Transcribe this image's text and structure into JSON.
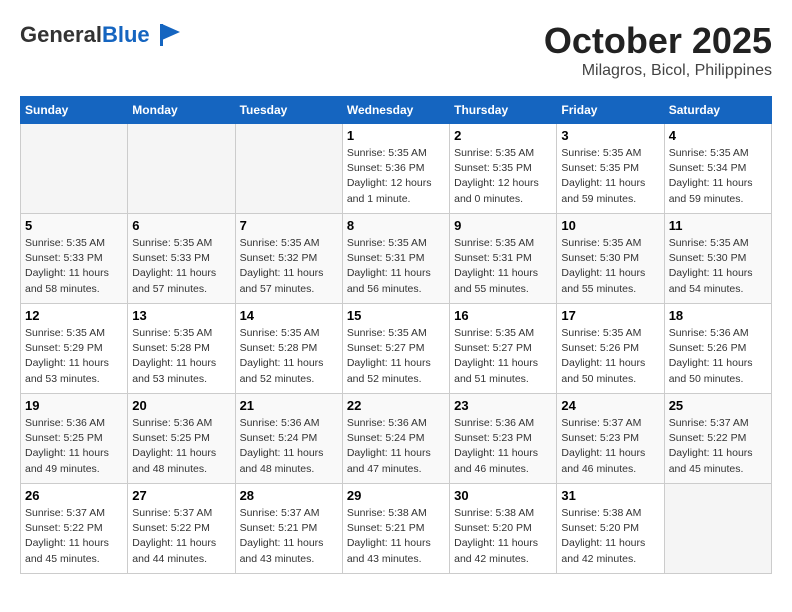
{
  "header": {
    "logo_general": "General",
    "logo_blue": "Blue",
    "month": "October 2025",
    "location": "Milagros, Bicol, Philippines"
  },
  "days_of_week": [
    "Sunday",
    "Monday",
    "Tuesday",
    "Wednesday",
    "Thursday",
    "Friday",
    "Saturday"
  ],
  "weeks": [
    [
      {
        "day": "",
        "info": ""
      },
      {
        "day": "",
        "info": ""
      },
      {
        "day": "",
        "info": ""
      },
      {
        "day": "1",
        "info": "Sunrise: 5:35 AM\nSunset: 5:36 PM\nDaylight: 12 hours\nand 1 minute."
      },
      {
        "day": "2",
        "info": "Sunrise: 5:35 AM\nSunset: 5:35 PM\nDaylight: 12 hours\nand 0 minutes."
      },
      {
        "day": "3",
        "info": "Sunrise: 5:35 AM\nSunset: 5:35 PM\nDaylight: 11 hours\nand 59 minutes."
      },
      {
        "day": "4",
        "info": "Sunrise: 5:35 AM\nSunset: 5:34 PM\nDaylight: 11 hours\nand 59 minutes."
      }
    ],
    [
      {
        "day": "5",
        "info": "Sunrise: 5:35 AM\nSunset: 5:33 PM\nDaylight: 11 hours\nand 58 minutes."
      },
      {
        "day": "6",
        "info": "Sunrise: 5:35 AM\nSunset: 5:33 PM\nDaylight: 11 hours\nand 57 minutes."
      },
      {
        "day": "7",
        "info": "Sunrise: 5:35 AM\nSunset: 5:32 PM\nDaylight: 11 hours\nand 57 minutes."
      },
      {
        "day": "8",
        "info": "Sunrise: 5:35 AM\nSunset: 5:31 PM\nDaylight: 11 hours\nand 56 minutes."
      },
      {
        "day": "9",
        "info": "Sunrise: 5:35 AM\nSunset: 5:31 PM\nDaylight: 11 hours\nand 55 minutes."
      },
      {
        "day": "10",
        "info": "Sunrise: 5:35 AM\nSunset: 5:30 PM\nDaylight: 11 hours\nand 55 minutes."
      },
      {
        "day": "11",
        "info": "Sunrise: 5:35 AM\nSunset: 5:30 PM\nDaylight: 11 hours\nand 54 minutes."
      }
    ],
    [
      {
        "day": "12",
        "info": "Sunrise: 5:35 AM\nSunset: 5:29 PM\nDaylight: 11 hours\nand 53 minutes."
      },
      {
        "day": "13",
        "info": "Sunrise: 5:35 AM\nSunset: 5:28 PM\nDaylight: 11 hours\nand 53 minutes."
      },
      {
        "day": "14",
        "info": "Sunrise: 5:35 AM\nSunset: 5:28 PM\nDaylight: 11 hours\nand 52 minutes."
      },
      {
        "day": "15",
        "info": "Sunrise: 5:35 AM\nSunset: 5:27 PM\nDaylight: 11 hours\nand 52 minutes."
      },
      {
        "day": "16",
        "info": "Sunrise: 5:35 AM\nSunset: 5:27 PM\nDaylight: 11 hours\nand 51 minutes."
      },
      {
        "day": "17",
        "info": "Sunrise: 5:35 AM\nSunset: 5:26 PM\nDaylight: 11 hours\nand 50 minutes."
      },
      {
        "day": "18",
        "info": "Sunrise: 5:36 AM\nSunset: 5:26 PM\nDaylight: 11 hours\nand 50 minutes."
      }
    ],
    [
      {
        "day": "19",
        "info": "Sunrise: 5:36 AM\nSunset: 5:25 PM\nDaylight: 11 hours\nand 49 minutes."
      },
      {
        "day": "20",
        "info": "Sunrise: 5:36 AM\nSunset: 5:25 PM\nDaylight: 11 hours\nand 48 minutes."
      },
      {
        "day": "21",
        "info": "Sunrise: 5:36 AM\nSunset: 5:24 PM\nDaylight: 11 hours\nand 48 minutes."
      },
      {
        "day": "22",
        "info": "Sunrise: 5:36 AM\nSunset: 5:24 PM\nDaylight: 11 hours\nand 47 minutes."
      },
      {
        "day": "23",
        "info": "Sunrise: 5:36 AM\nSunset: 5:23 PM\nDaylight: 11 hours\nand 46 minutes."
      },
      {
        "day": "24",
        "info": "Sunrise: 5:37 AM\nSunset: 5:23 PM\nDaylight: 11 hours\nand 46 minutes."
      },
      {
        "day": "25",
        "info": "Sunrise: 5:37 AM\nSunset: 5:22 PM\nDaylight: 11 hours\nand 45 minutes."
      }
    ],
    [
      {
        "day": "26",
        "info": "Sunrise: 5:37 AM\nSunset: 5:22 PM\nDaylight: 11 hours\nand 45 minutes."
      },
      {
        "day": "27",
        "info": "Sunrise: 5:37 AM\nSunset: 5:22 PM\nDaylight: 11 hours\nand 44 minutes."
      },
      {
        "day": "28",
        "info": "Sunrise: 5:37 AM\nSunset: 5:21 PM\nDaylight: 11 hours\nand 43 minutes."
      },
      {
        "day": "29",
        "info": "Sunrise: 5:38 AM\nSunset: 5:21 PM\nDaylight: 11 hours\nand 43 minutes."
      },
      {
        "day": "30",
        "info": "Sunrise: 5:38 AM\nSunset: 5:20 PM\nDaylight: 11 hours\nand 42 minutes."
      },
      {
        "day": "31",
        "info": "Sunrise: 5:38 AM\nSunset: 5:20 PM\nDaylight: 11 hours\nand 42 minutes."
      },
      {
        "day": "",
        "info": ""
      }
    ]
  ]
}
